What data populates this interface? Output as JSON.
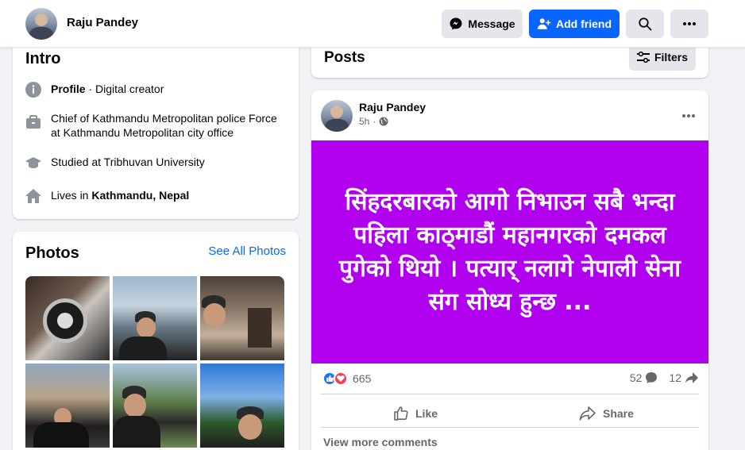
{
  "header": {
    "name": "Raju Pandey",
    "message_label": "Message",
    "add_friend_label": "Add friend"
  },
  "intro": {
    "title": "Intro",
    "profile_label": "Profile",
    "profile_value": " · Digital creator",
    "work_line1": "Chief of Kathmandu Metropolitan police Force",
    "work_line2": "at Kathmandu Metropolitan city office",
    "education": "Studied at Tribhuvan University",
    "lives_prefix": "Lives in ",
    "lives_place": "Kathmandu, Nepal"
  },
  "photos": {
    "title": "Photos",
    "see_all": "See All Photos"
  },
  "posts": {
    "title": "Posts",
    "filters_label": "Filters"
  },
  "post": {
    "author": "Raju Pandey",
    "time": "5h",
    "banner_text": "सिंहदरबारको आगो निभाउन सबै भन्दा पहिला काठ्माडौं महानगरको दमकल पुगेको थियो । पत्यार् नलागे नेपाली सेना संग सोध्य हुन्छ ...",
    "reaction_count": "665",
    "comment_count": "52",
    "share_count": "12",
    "like_label": "Like",
    "share_label": "Share",
    "view_more": "View more comments"
  },
  "colors": {
    "accent": "#0866ff",
    "banner": "#b000ee",
    "like": "#1877f2",
    "love": "#f33e58"
  }
}
